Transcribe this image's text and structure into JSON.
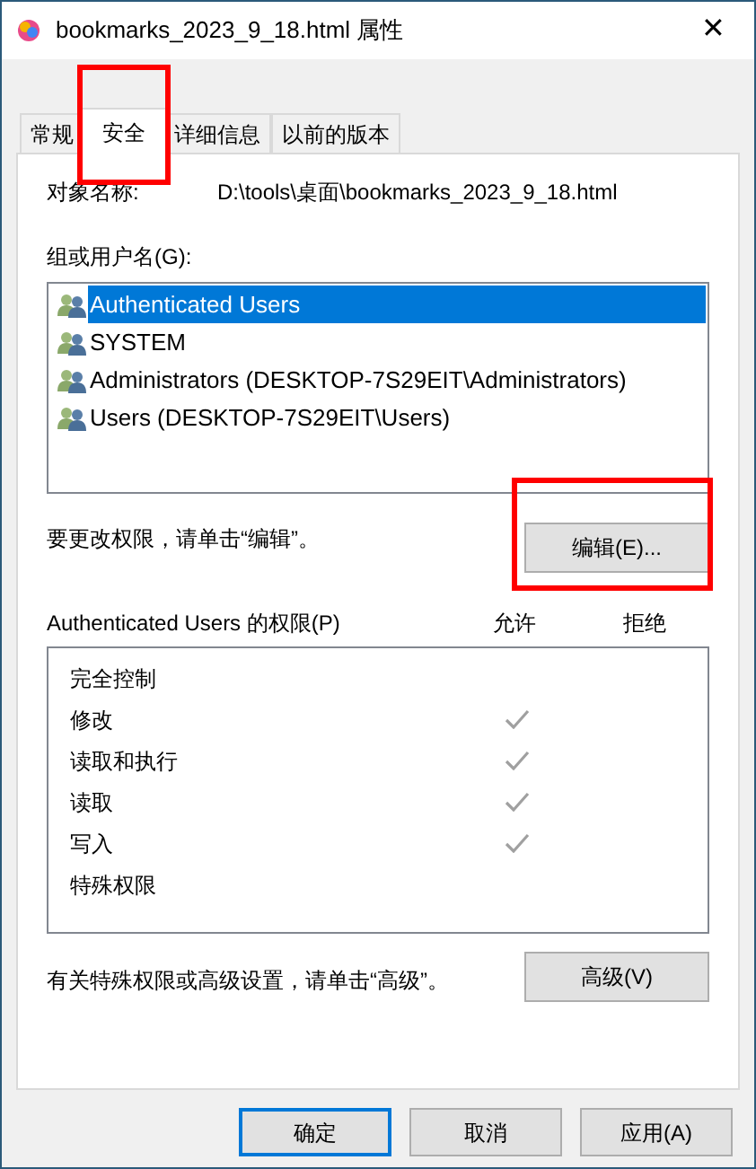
{
  "window": {
    "title": "bookmarks_2023_9_18.html 属性",
    "close": "✕"
  },
  "tabs": [
    {
      "label": "常规",
      "selected": false,
      "highlighted": false
    },
    {
      "label": "安全",
      "selected": true,
      "highlighted": true
    },
    {
      "label": "详细信息",
      "selected": false,
      "highlighted": false
    },
    {
      "label": "以前的版本",
      "selected": false,
      "highlighted": false
    }
  ],
  "object_name": {
    "label": "对象名称:",
    "value": "D:\\tools\\桌面\\bookmarks_2023_9_18.html"
  },
  "groups": {
    "label": "组或用户名(G):",
    "items": [
      {
        "name": "Authenticated Users",
        "selected": true
      },
      {
        "name": "SYSTEM",
        "selected": false
      },
      {
        "name": "Administrators (DESKTOP-7S29EIT\\Administrators)",
        "selected": false
      },
      {
        "name": "Users (DESKTOP-7S29EIT\\Users)",
        "selected": false
      }
    ]
  },
  "edit": {
    "hint": "要更改权限，请单击“编辑”。",
    "button": "编辑(E)...",
    "highlighted": true
  },
  "permissions": {
    "label": "Authenticated Users 的权限(P)",
    "allow_header": "允许",
    "deny_header": "拒绝",
    "rows": [
      {
        "name": "完全控制",
        "allow": false,
        "deny": false
      },
      {
        "name": "修改",
        "allow": true,
        "deny": false
      },
      {
        "name": "读取和执行",
        "allow": true,
        "deny": false
      },
      {
        "name": "读取",
        "allow": true,
        "deny": false
      },
      {
        "name": "写入",
        "allow": true,
        "deny": false
      },
      {
        "name": "特殊权限",
        "allow": false,
        "deny": false
      }
    ]
  },
  "advanced": {
    "hint": "有关特殊权限或高级设置，请单击“高级”。",
    "button": "高级(V)"
  },
  "buttons": [
    {
      "label": "确定",
      "default": true
    },
    {
      "label": "取消",
      "default": false
    },
    {
      "label": "应用(A)",
      "default": false
    }
  ]
}
